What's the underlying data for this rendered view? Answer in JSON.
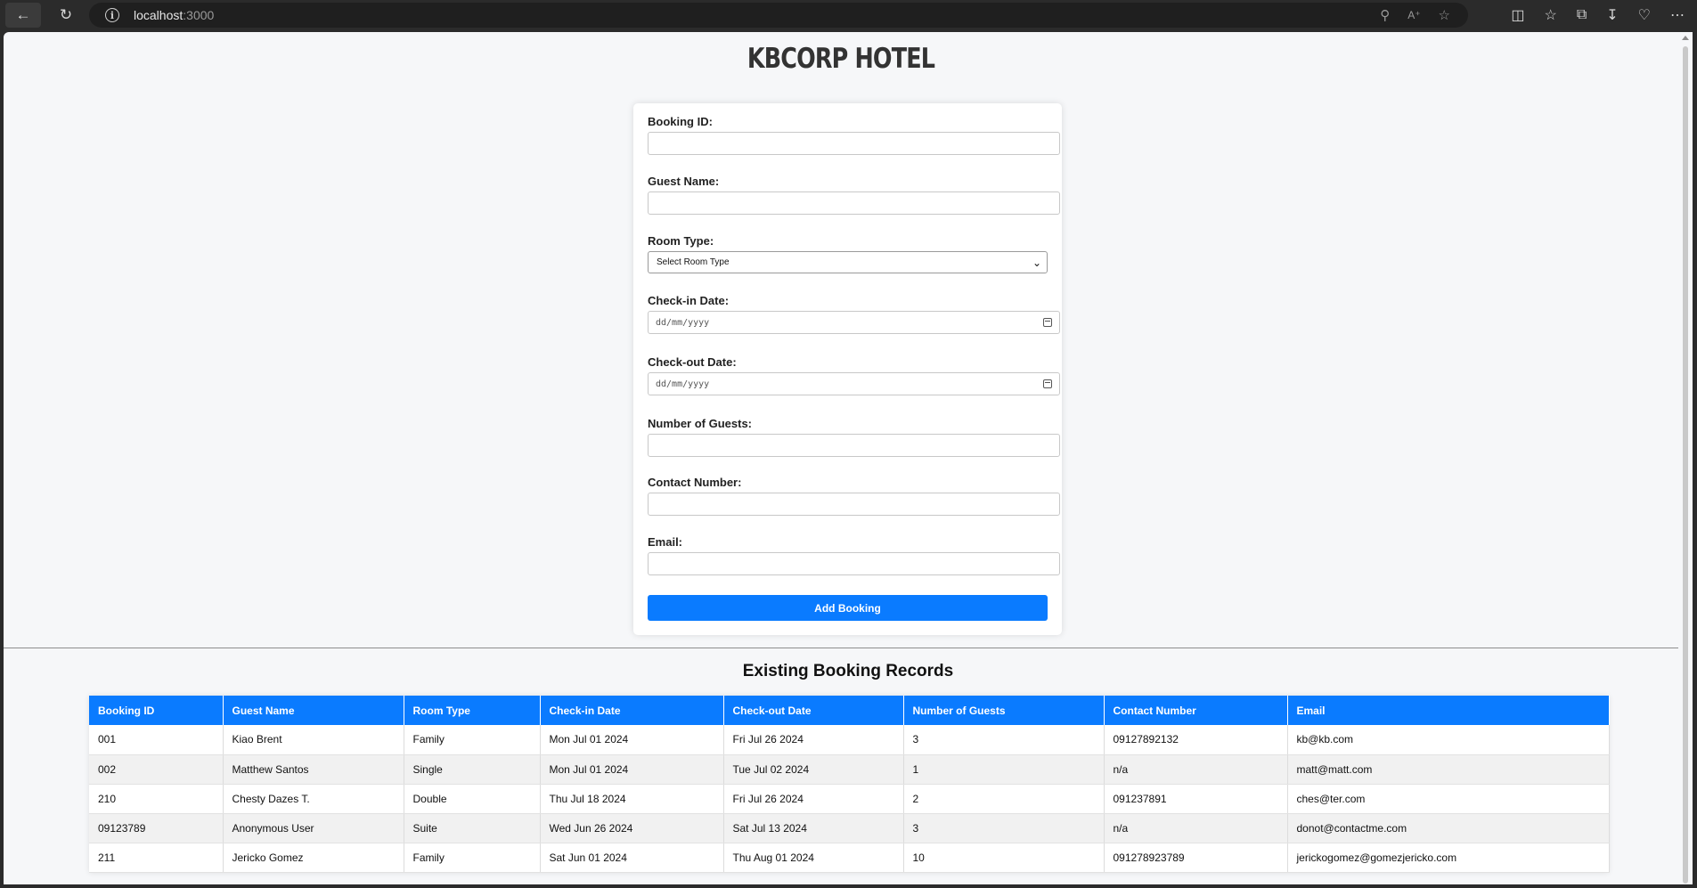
{
  "browser": {
    "url_host": "localhost",
    "url_port": ":3000"
  },
  "page": {
    "title": "KBCORP HOTEL"
  },
  "form": {
    "booking_id_label": "Booking ID:",
    "guest_name_label": "Guest Name:",
    "room_type_label": "Room Type:",
    "room_type_selected": "Select Room Type",
    "checkin_label": "Check-in Date:",
    "checkin_placeholder": "dd/mm/yyyy",
    "checkout_label": "Check-out Date:",
    "checkout_placeholder": "dd/mm/yyyy",
    "guests_label": "Number of Guests:",
    "contact_label": "Contact Number:",
    "email_label": "Email:",
    "submit_label": "Add Booking",
    "booking_id_value": "",
    "guest_name_value": "",
    "guests_value": "",
    "contact_value": "",
    "email_value": ""
  },
  "records": {
    "title": "Existing Booking Records",
    "columns": [
      "Booking ID",
      "Guest Name",
      "Room Type",
      "Check-in Date",
      "Check-out Date",
      "Number of Guests",
      "Contact Number",
      "Email"
    ],
    "rows": [
      [
        "001",
        "Kiao Brent",
        "Family",
        "Mon Jul 01 2024",
        "Fri Jul 26 2024",
        "3",
        "09127892132",
        "kb@kb.com"
      ],
      [
        "002",
        "Matthew Santos",
        "Single",
        "Mon Jul 01 2024",
        "Tue Jul 02 2024",
        "1",
        "n/a",
        "matt@matt.com"
      ],
      [
        "210",
        "Chesty Dazes T.",
        "Double",
        "Thu Jul 18 2024",
        "Fri Jul 26 2024",
        "2",
        "091237891",
        "ches@ter.com"
      ],
      [
        "09123789",
        "Anonymous User",
        "Suite",
        "Wed Jun 26 2024",
        "Sat Jul 13 2024",
        "3",
        "n/a",
        "donot@contactme.com"
      ],
      [
        "211",
        "Jericko Gomez",
        "Family",
        "Sat Jun 01 2024",
        "Thu Aug 01 2024",
        "10",
        "091278923789",
        "jerickogomez@gomezjericko.com"
      ]
    ]
  }
}
